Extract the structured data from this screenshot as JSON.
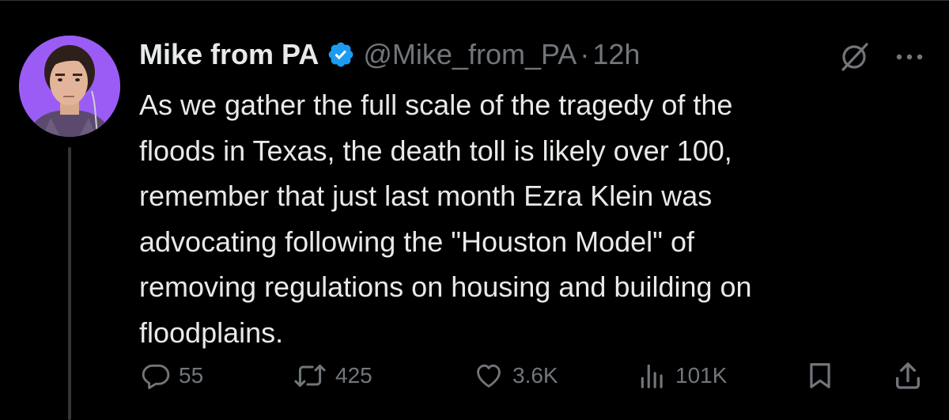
{
  "author": {
    "display_name": "Mike from PA",
    "handle": "@Mike_from_PA",
    "separator": "·",
    "time": "12h"
  },
  "tweet": {
    "lines": [
      "As we gather the full scale of the tragedy of the",
      "floods in Texas, the death toll is likely over 100,",
      "remember that just last month Ezra Klein was",
      "advocating following the \"Houston Model\" of",
      "removing regulations on housing and building on",
      "floodplains."
    ]
  },
  "actions": {
    "replies": "55",
    "reposts": "425",
    "likes": "3.6K",
    "views": "101K"
  },
  "icons": {
    "verified": "verified-badge-icon",
    "grok": "grok-icon",
    "more": "more-dots-icon",
    "reply": "reply-icon",
    "repost": "repost-icon",
    "like": "heart-icon",
    "views": "views-bar-chart-icon",
    "bookmark": "bookmark-icon",
    "share": "share-icon"
  },
  "colors": {
    "background": "#000000",
    "text_primary": "#e7e9ea",
    "text_secondary": "#71767b",
    "verified_blue": "#1d9bf0",
    "avatar_bg": "#9b5cf6",
    "thread_line": "#333639"
  }
}
